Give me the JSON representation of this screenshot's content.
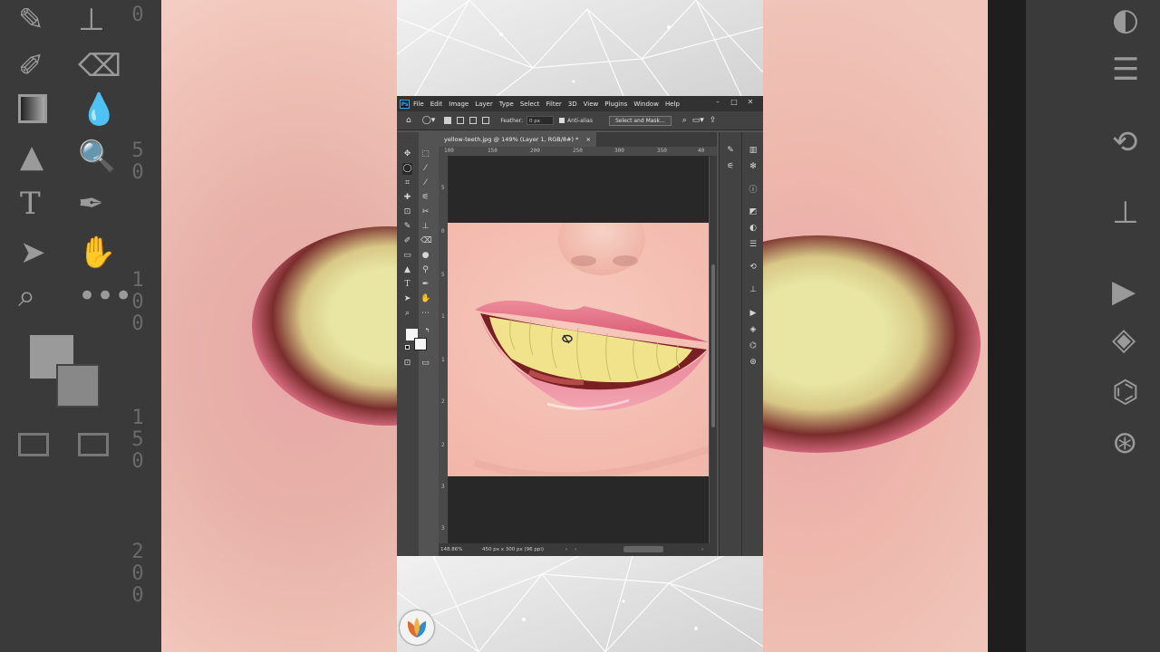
{
  "menubar": {
    "app_badge": "Ps",
    "items": [
      "File",
      "Edit",
      "Image",
      "Layer",
      "Type",
      "Select",
      "Filter",
      "3D",
      "View",
      "Plugins",
      "Window",
      "Help"
    ],
    "controls": {
      "minimize": "–",
      "maximize": "□",
      "close": "✕"
    }
  },
  "options": {
    "feather_label": "Feather:",
    "feather_value": "0 px",
    "antialias_label": "Anti-alias",
    "select_mask_label": "Select and Mask..."
  },
  "document": {
    "tab_title": "yellow-teeth.jpg @ 149% (Layer 1, RGB/8#) *",
    "ruler_h": [
      "100",
      "150",
      "200",
      "250",
      "300",
      "350",
      "40"
    ],
    "ruler_v": [
      "5",
      "0",
      "5",
      "1",
      "1",
      "2",
      "2",
      "3",
      "3"
    ],
    "zoom": "148.86%",
    "doc_info": "450 px x 300 px (96 ppi)"
  },
  "background_ruler_numbers": [
    "0",
    "5 0",
    "1 0 0",
    "1 5 0",
    "2 0 0"
  ],
  "tools": [
    "move-icon",
    "marquee-icon",
    "lasso-icon",
    "magic-wand-icon",
    "crop-icon",
    "eyedropper-icon",
    "healing-icon",
    "ruler-icon",
    "patch-icon",
    "clone-icon",
    "brush-icon",
    "stamp-icon",
    "history-brush-icon",
    "eraser-icon",
    "gradient-icon",
    "blur-icon",
    "shape-icon",
    "pen-icon",
    "type-icon",
    "path-select-icon",
    "direct-select-icon",
    "hand-icon",
    "zoom-icon",
    "more-icon"
  ],
  "colors": {
    "photoshop_blue": "#31a8ff",
    "ui_dark": "#323232",
    "ui_mid": "#535353",
    "lip_pink": "#e46b84",
    "teeth_yellow": "#f3ea95"
  }
}
